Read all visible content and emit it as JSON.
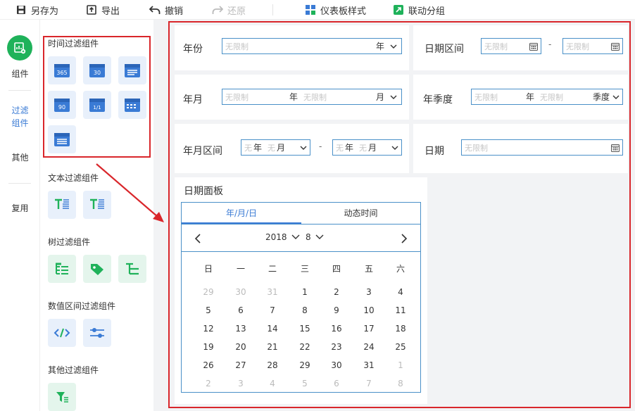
{
  "toolbar": {
    "save_as": "另存为",
    "export": "导出",
    "undo": "撤销",
    "redo": "还原",
    "dashboard_style": "仪表板样式",
    "linkage_group": "联动分组"
  },
  "leftnav": {
    "components": "组件",
    "filter_components": "过滤\n组件",
    "other": "其他",
    "reuse": "复用"
  },
  "panel": {
    "time_filter": "时间过滤组件",
    "text_filter": "文本过滤组件",
    "tree_filter": "树过滤组件",
    "numeric_range_filter": "数值区间过滤组件",
    "other_filter": "其他过滤组件",
    "icon_texts": {
      "c365": "365",
      "c30": "30",
      "c90": "90",
      "c11": "1/1"
    }
  },
  "widgets": {
    "year": {
      "label": "年份",
      "placeholder": "无限制",
      "unit": "年"
    },
    "year_month": {
      "label": "年月",
      "placeholder1": "无限制",
      "unit1": "年",
      "placeholder2": "无限制",
      "unit2": "月"
    },
    "year_month_range": {
      "label": "年月区间",
      "ph": "无",
      "unit_year": "年",
      "unit_month": "月",
      "dash": "-"
    },
    "date_range": {
      "label": "日期区间",
      "placeholder_start": "无限制",
      "placeholder_end": "无限制",
      "dash": "-"
    },
    "year_quarter": {
      "label": "年季度",
      "placeholder1": "无限制",
      "unit1": "年",
      "placeholder2": "无限制",
      "unit2": "季度"
    },
    "date": {
      "label": "日期",
      "placeholder": "无限制"
    }
  },
  "date_panel": {
    "label": "日期面板",
    "tab_ymd": "年/月/日",
    "tab_dynamic": "动态时间",
    "year": "2018",
    "month": "8",
    "weekdays": [
      "日",
      "一",
      "二",
      "三",
      "四",
      "五",
      "六"
    ],
    "weeks": [
      [
        "29",
        "30",
        "31",
        "1",
        "2",
        "3",
        "4"
      ],
      [
        "5",
        "6",
        "7",
        "8",
        "9",
        "10",
        "11"
      ],
      [
        "12",
        "13",
        "14",
        "15",
        "16",
        "17",
        "18"
      ],
      [
        "19",
        "20",
        "21",
        "22",
        "23",
        "24",
        "25"
      ],
      [
        "26",
        "27",
        "28",
        "29",
        "30",
        "31",
        "1"
      ],
      [
        "2",
        "3",
        "4",
        "5",
        "6",
        "7",
        "8"
      ]
    ],
    "muted": [
      [
        true,
        true,
        true,
        false,
        false,
        false,
        false
      ],
      [
        false,
        false,
        false,
        false,
        false,
        false,
        false
      ],
      [
        false,
        false,
        false,
        false,
        false,
        false,
        false
      ],
      [
        false,
        false,
        false,
        false,
        false,
        false,
        false
      ],
      [
        false,
        false,
        false,
        false,
        false,
        false,
        true
      ],
      [
        true,
        true,
        true,
        true,
        true,
        true,
        true
      ]
    ]
  },
  "colors": {
    "accent": "#3a7bd5",
    "highlight": "#d9262b",
    "brand_green": "#1fb25a",
    "field_border": "#4a90c8"
  }
}
